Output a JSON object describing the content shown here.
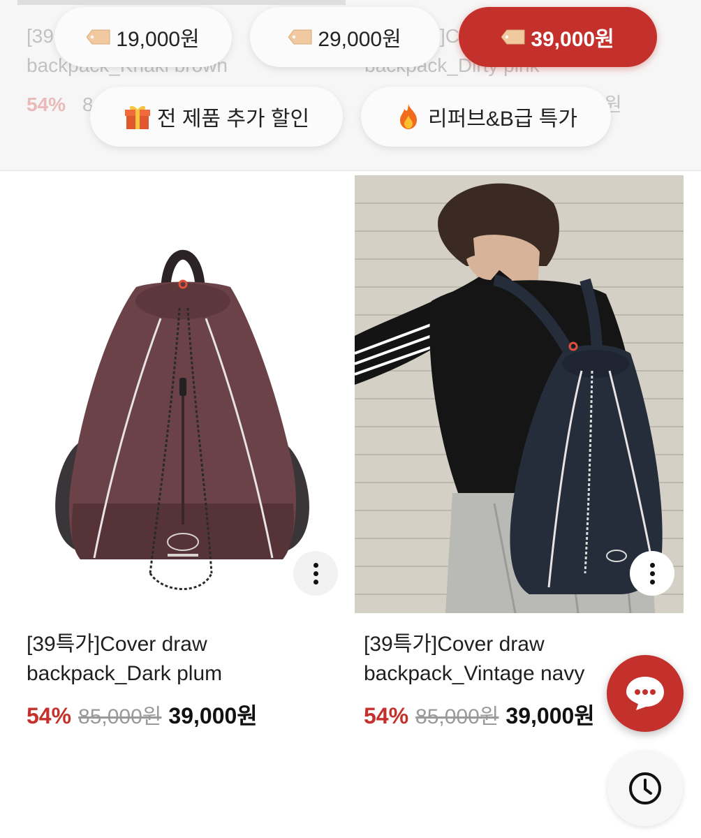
{
  "filter_header": {
    "ghost_texts": {
      "left_title_1": "[39",
      "left_title_2": "backpack_Khaki brown",
      "left_discount": "54%",
      "left_original": "8",
      "right_title_1": "]C",
      "right_title_2": "backpack_Dirty pink",
      "right_price_tail": "원"
    },
    "price_filters": [
      {
        "label": "19,000원",
        "active": false
      },
      {
        "label": "29,000원",
        "active": false
      },
      {
        "label": "39,000원",
        "active": true
      }
    ],
    "category_filters": [
      {
        "label": "전 제품 추가 할인",
        "icon": "gift-icon"
      },
      {
        "label": "리퍼브&B급 특가",
        "icon": "fire-icon"
      }
    ]
  },
  "products": [
    {
      "title_line1": "[39특가]Cover draw",
      "title_line2": "backpack_Dark plum",
      "discount": "54%",
      "original_price": "85,000원",
      "sale_price": "39,000원",
      "image": "plum-backpack-product-photo"
    },
    {
      "title_line1": "[39특가]Cover draw",
      "title_line2": "backpack_Vintage navy",
      "discount": "54%",
      "original_price": "85,000원",
      "sale_price": "39,000원",
      "image": "navy-backpack-model-photo"
    }
  ],
  "floating": {
    "chat_icon": "chat-bubble-icon",
    "history_icon": "clock-icon"
  },
  "colors": {
    "accent": "#c4302b",
    "plum": "#6b4247",
    "navy": "#252c3a"
  }
}
